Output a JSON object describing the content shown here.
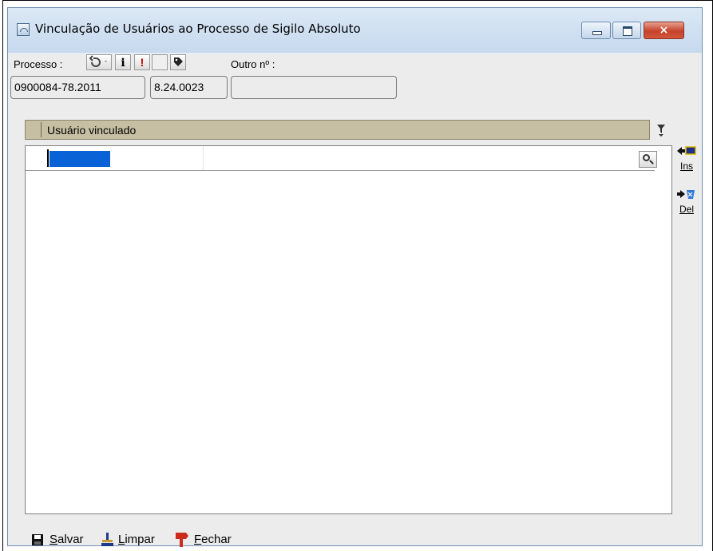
{
  "window": {
    "title": "Vinculação de Usuários ao Processo de Sigilo Absoluto",
    "controls": {
      "close_glyph": "×"
    }
  },
  "header": {
    "processo_label": "Processo :",
    "outro_label": "Outro nº :",
    "icons": [
      "undo-icon",
      "info-icon",
      "alert-icon",
      "blank-icon",
      "tag-icon"
    ],
    "info_glyph": "i",
    "alert_glyph": "!"
  },
  "fields": {
    "process_number": "0900084-78.2011",
    "process_code": "8.24.0023",
    "outro_numero": ""
  },
  "grid": {
    "column_header": "Usuário vinculado",
    "rows": [
      {
        "value": ""
      }
    ]
  },
  "side_actions": {
    "insert_label": "Ins",
    "delete_label": "Del"
  },
  "footer": {
    "save_label": "Salvar",
    "clear_label": "Limpar",
    "close_label": "Fechar"
  },
  "colors": {
    "grid_header_bg": "#c7bfa3",
    "selection_blue": "#0a63d6",
    "close_button_red": "#c5432b"
  }
}
